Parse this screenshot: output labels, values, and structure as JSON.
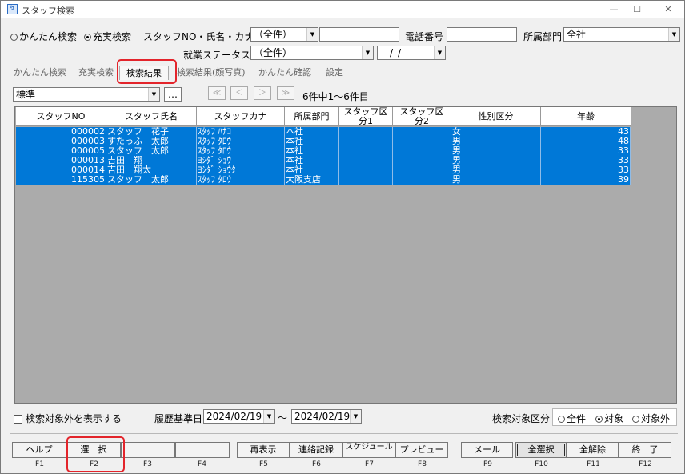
{
  "window": {
    "title": "スタッフ検索",
    "minimize": "—",
    "maximize": "☐",
    "close": "✕",
    "icon": "app-icon"
  },
  "mode": {
    "simple_label": "かんたん検索",
    "detail_label": "充実検索",
    "selected": "detail"
  },
  "search": {
    "staff_label": "スタッフNO・氏名・カナ",
    "staff_combo": "（全件）",
    "phone_label": "電話番号",
    "dept_label": "所属部門",
    "dept_value": "全社",
    "employment_label": "就業ステータス",
    "employment_value": "（全件）",
    "date_value": "__/_/_"
  },
  "tabs": [
    {
      "label": "かんたん検索"
    },
    {
      "label": "充実検索"
    },
    {
      "label": "検索結果"
    },
    {
      "label": "検索結果(顔写真)"
    },
    {
      "label": "かんたん確認"
    },
    {
      "label": "設定"
    }
  ],
  "view": {
    "preset": "標準",
    "more": "…",
    "first": "≪",
    "prev": "＜",
    "next": "＞",
    "last": "≫",
    "count": "6件中1～6件目"
  },
  "grid": {
    "columns": [
      "スタッフNO",
      "スタッフ氏名",
      "スタッフカナ",
      "所属部門",
      "スタッフ区分1",
      "スタッフ区分2",
      "性別区分",
      "年齢"
    ],
    "rows": [
      [
        "000002",
        "スタッフ　花子",
        "ｽﾀｯﾌ ﾊﾅｺ",
        "本社",
        "",
        "",
        "女",
        "43"
      ],
      [
        "000003",
        "すたっふ　太郎",
        "ｽﾀｯﾌ ﾀﾛｳ",
        "本社",
        "",
        "",
        "男",
        "48"
      ],
      [
        "000005",
        "スタッフ　太郎",
        "ｽﾀｯﾌ ﾀﾛｳ",
        "本社",
        "",
        "",
        "男",
        "33"
      ],
      [
        "000013",
        "吉田　翔",
        "ﾖｼﾀﾞ ｼｮｳ",
        "本社",
        "",
        "",
        "男",
        "33"
      ],
      [
        "000014",
        "吉田　翔太",
        "ﾖｼﾀﾞ ｼｮｳﾀ",
        "本社",
        "",
        "",
        "男",
        "33"
      ],
      [
        "115305",
        "スタッフ　太郎",
        "ｽﾀｯﾌ ﾀﾛｳ",
        "大阪支店",
        "",
        "",
        "男",
        "39"
      ]
    ]
  },
  "bottom": {
    "show_excluded": "検索対象外を表示する",
    "history_label": "履歴基準日",
    "date_from": "2024/02/19",
    "tilde": "～",
    "date_to": "2024/02/19",
    "target_label": "検索対象区分",
    "target_all": "全件",
    "target_on": "対象",
    "target_off": "対象外"
  },
  "buttons": [
    {
      "label": "ヘルプ",
      "key": "F1"
    },
    {
      "label": "選　択",
      "key": "F2"
    },
    {
      "label": "",
      "key": "F3"
    },
    {
      "label": "",
      "key": "F4"
    },
    {
      "label": "再表示",
      "key": "F5"
    },
    {
      "label": "連絡記録",
      "key": "F6"
    },
    {
      "label": "スケジュール",
      "key": "F7"
    },
    {
      "label": "プレビュー",
      "key": "F8"
    },
    {
      "label": "メール",
      "key": "F9"
    },
    {
      "label": "全選択",
      "key": "F10"
    },
    {
      "label": "全解除",
      "key": "F11"
    },
    {
      "label": "終　了",
      "key": "F12"
    }
  ]
}
